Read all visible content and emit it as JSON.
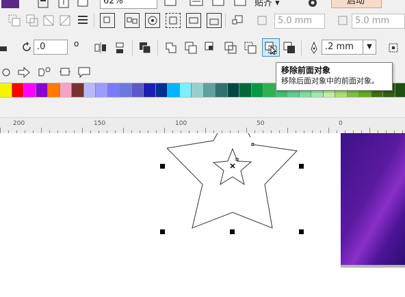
{
  "toolbar_top": {
    "zoom_value": "62%",
    "snap_label": "贴齐",
    "launch_label": "启动",
    "nudge_x": "5.0 mm",
    "nudge_y": "5.0 mm"
  },
  "property_bar": {
    "rotation_value": ".0",
    "degree_symbol": "o",
    "outline_width": ".2 mm"
  },
  "tooltip": {
    "title": "移除前面对象",
    "description": "移除后面对象中的前面对象。"
  },
  "palette": {
    "colors": [
      "#f5f500",
      "#ff0000",
      "#ff00ff",
      "#8a00d4",
      "#ff7a00",
      "#ff9ec6",
      "#7a3030",
      "#b8b8ff",
      "#9c9cff",
      "#7a7aff",
      "#6a78e0",
      "#5a5ac8",
      "#1e1eb4",
      "#003090",
      "#00b4ff",
      "#7af0ff",
      "#98d0d0",
      "#60a0a0",
      "#307070",
      "#004848",
      "#006a3c",
      "#009a44",
      "#30b050",
      "#40c070",
      "#60d090",
      "#80e0a0",
      "#a0e8b0",
      "#c0f0a0",
      "#a8e070",
      "#80c040",
      "#60b020",
      "#407010",
      "#306010",
      "#205010"
    ]
  },
  "ruler": {
    "labels": [
      "200",
      "150",
      "100",
      "50",
      "0"
    ]
  },
  "canvas": {
    "selection_color": "#000000",
    "shape_stroke": "#333333"
  }
}
